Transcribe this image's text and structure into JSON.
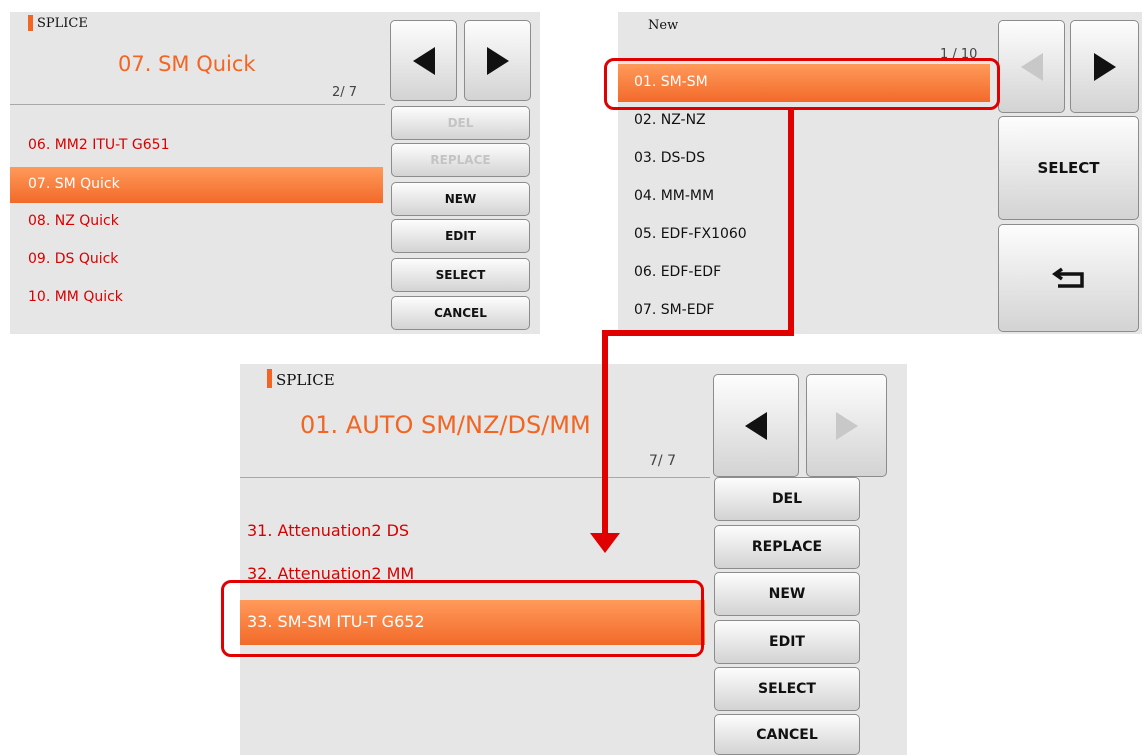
{
  "colors": {
    "accent": "#f26522",
    "item_text": "#d90000",
    "callout": "#e00000",
    "panel_bg": "#e6e6e6"
  },
  "panel1": {
    "header": "SPLICE",
    "title": "07. SM Quick",
    "page": "2/ 7",
    "items": [
      "06. MM2 ITU-T G651",
      "07. SM Quick",
      "08. NZ Quick",
      "09. DS Quick",
      "10. MM Quick"
    ],
    "selected": "07. SM Quick",
    "buttons": {
      "del": "DEL",
      "replace": "REPLACE",
      "new": "NEW",
      "edit": "EDIT",
      "select": "SELECT",
      "cancel": "CANCEL"
    },
    "nav": {
      "prev_icon": "arrow-left-icon",
      "next_icon": "arrow-right-icon"
    }
  },
  "panel2": {
    "header": "New",
    "page": "1 / 10",
    "items": [
      "01. SM-SM",
      "02. NZ-NZ",
      "03. DS-DS",
      "04. MM-MM",
      "05. EDF-FX1060",
      "06. EDF-EDF",
      "07. SM-EDF"
    ],
    "selected": "01. SM-SM",
    "buttons": {
      "select": "SELECT"
    },
    "nav": {
      "prev_icon": "arrow-left-icon",
      "next_icon": "arrow-right-icon",
      "back_icon": "return-icon"
    }
  },
  "panel3": {
    "header": "SPLICE",
    "title": "01. AUTO SM/NZ/DS/MM",
    "page": "7/ 7",
    "items": [
      "31. Attenuation2 DS",
      "32. Attenuation2 MM",
      "33. SM-SM ITU-T G652"
    ],
    "selected": "33. SM-SM ITU-T G652",
    "buttons": {
      "del": "DEL",
      "replace": "REPLACE",
      "new": "NEW",
      "edit": "EDIT",
      "select": "SELECT",
      "cancel": "CANCEL"
    },
    "nav": {
      "prev_icon": "arrow-left-icon",
      "next_icon": "arrow-right-icon"
    }
  }
}
